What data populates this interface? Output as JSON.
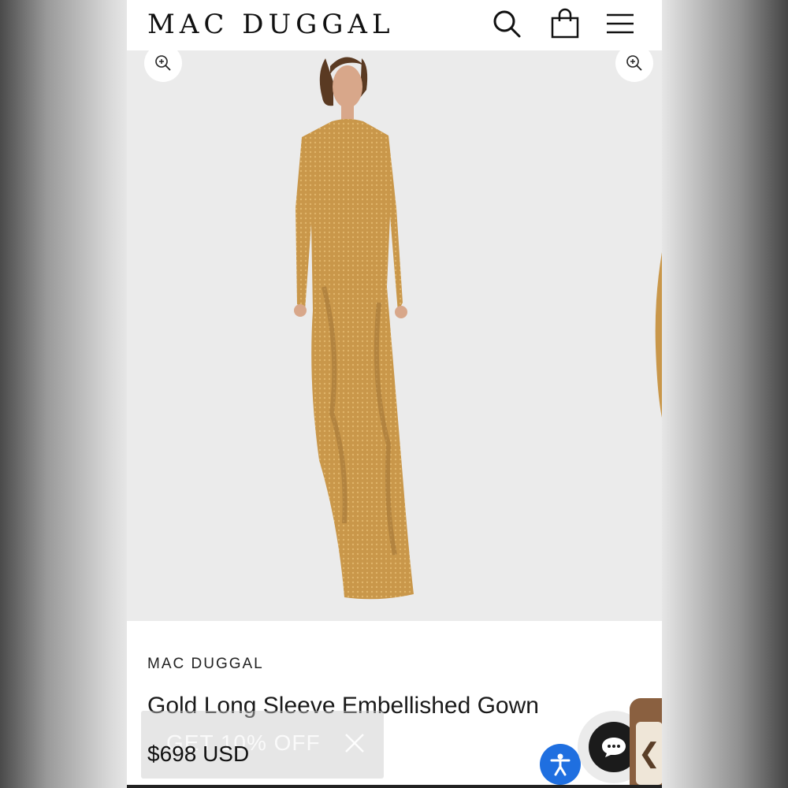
{
  "header": {
    "logo": "MAC DUGGAL",
    "icons": [
      "search-icon",
      "shopping-bag-icon",
      "menu-icon"
    ]
  },
  "gallery": {
    "zoom_icon": "zoom-in-icon",
    "image": "gold-gown-model-image"
  },
  "product": {
    "brand": "MAC DUGGAL",
    "title": "Gold Long Sleeve Embellished Gown",
    "price": "$698 USD"
  },
  "promo": {
    "text": "GET 10% OFF",
    "close_icon": "close-icon"
  },
  "widgets": {
    "accessibility_icon": "accessibility-icon",
    "chat_icon": "chat-icon",
    "side_tab_icon": "chevron-left-icon"
  },
  "colors": {
    "gown": "#c9974a",
    "accessibility": "#1f6fe0",
    "side_tab": "#8a6040"
  }
}
